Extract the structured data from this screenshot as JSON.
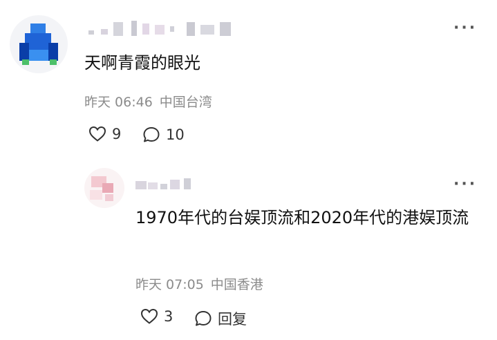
{
  "comments": [
    {
      "username": "",
      "content": "天啊青霞的眼光",
      "time": "昨天 06:46",
      "location": "中国台湾",
      "likes": "9",
      "replies": "10",
      "more_icon": "more-dots-icon",
      "avatar_colors": [
        "#1f63d6",
        "#2e8be8",
        "#0a3ea8",
        "#4dc06a"
      ]
    },
    {
      "username": "",
      "content": "1970年代的台娱顶流和2020年代的港娱顶流",
      "time": "昨天 07:05",
      "location": "中国香港",
      "likes": "3",
      "reply_label": "回复",
      "more_icon": "more-dots-icon",
      "avatar_colors": [
        "#f3c9d0",
        "#e9a9b5",
        "#f8e1e5"
      ]
    }
  ],
  "icons": {
    "like": "heart-outline-icon",
    "comment": "speech-bubble-icon"
  }
}
